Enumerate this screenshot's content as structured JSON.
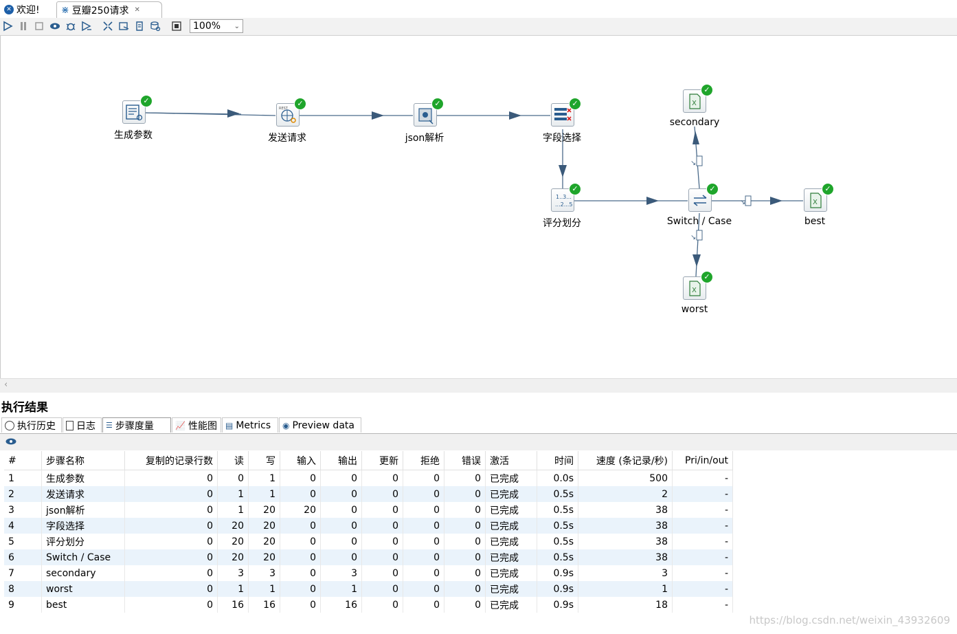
{
  "tabs": [
    {
      "label": "欢迎!",
      "icon": "spoon-icon"
    },
    {
      "label": "豆瓣250请求",
      "icon": "transformation-icon"
    }
  ],
  "toolbar": {
    "zoom": "100%"
  },
  "canvas": {
    "steps": [
      {
        "id": "gen",
        "label": "生成参数"
      },
      {
        "id": "req",
        "label": "发送请求"
      },
      {
        "id": "json",
        "label": "json解析"
      },
      {
        "id": "sel",
        "label": "字段选择"
      },
      {
        "id": "score",
        "label": "评分划分"
      },
      {
        "id": "switch",
        "label": "Switch / Case"
      },
      {
        "id": "secondary",
        "label": "secondary"
      },
      {
        "id": "best",
        "label": "best"
      },
      {
        "id": "worst",
        "label": "worst"
      }
    ]
  },
  "results": {
    "title": "执行结果",
    "tabs": [
      "执行历史",
      "日志",
      "步骤度量",
      "性能图",
      "Metrics",
      "Preview data"
    ],
    "columns": [
      "#",
      "步骤名称",
      "复制的记录行数",
      "读",
      "写",
      "输入",
      "输出",
      "更新",
      "拒绝",
      "错误",
      "激活",
      "时间",
      "速度 (条记录/秒)",
      "Pri/in/out"
    ],
    "rows": [
      [
        "1",
        "生成参数",
        "0",
        "0",
        "1",
        "0",
        "0",
        "0",
        "0",
        "0",
        "已完成",
        "0.0s",
        "500",
        "-"
      ],
      [
        "2",
        "发送请求",
        "0",
        "1",
        "1",
        "0",
        "0",
        "0",
        "0",
        "0",
        "已完成",
        "0.5s",
        "2",
        "-"
      ],
      [
        "3",
        "json解析",
        "0",
        "1",
        "20",
        "20",
        "0",
        "0",
        "0",
        "0",
        "已完成",
        "0.5s",
        "38",
        "-"
      ],
      [
        "4",
        "字段选择",
        "0",
        "20",
        "20",
        "0",
        "0",
        "0",
        "0",
        "0",
        "已完成",
        "0.5s",
        "38",
        "-"
      ],
      [
        "5",
        "评分划分",
        "0",
        "20",
        "20",
        "0",
        "0",
        "0",
        "0",
        "0",
        "已完成",
        "0.5s",
        "38",
        "-"
      ],
      [
        "6",
        "Switch / Case",
        "0",
        "20",
        "20",
        "0",
        "0",
        "0",
        "0",
        "0",
        "已完成",
        "0.5s",
        "38",
        "-"
      ],
      [
        "7",
        "secondary",
        "0",
        "3",
        "3",
        "0",
        "3",
        "0",
        "0",
        "0",
        "已完成",
        "0.9s",
        "3",
        "-"
      ],
      [
        "8",
        "worst",
        "0",
        "1",
        "1",
        "0",
        "1",
        "0",
        "0",
        "0",
        "已完成",
        "0.9s",
        "1",
        "-"
      ],
      [
        "9",
        "best",
        "0",
        "16",
        "16",
        "0",
        "16",
        "0",
        "0",
        "0",
        "已完成",
        "0.9s",
        "18",
        "-"
      ]
    ]
  },
  "watermark": "https://blog.csdn.net/weixin_43932609"
}
